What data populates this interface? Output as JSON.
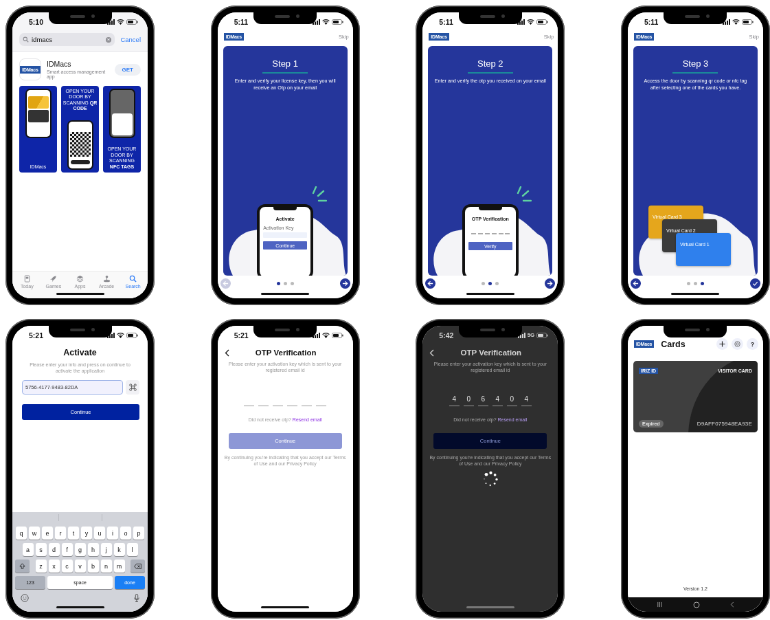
{
  "phones": [
    {
      "kind": "appstore",
      "time": "5:10",
      "search": {
        "value": "idmacs"
      },
      "cancel": "Cancel",
      "app": {
        "logo": "IDMacs",
        "name": "IDMacs",
        "subtitle": "Smart access management app",
        "button": "GET"
      },
      "previews": [
        {
          "kind": "cards",
          "caption": "IDMacs"
        },
        {
          "kind": "qr",
          "caption": "OPEN YOUR DOOR BY SCANNING **QR CODE**"
        },
        {
          "kind": "nfc",
          "caption": "OPEN YOUR DOOR BY SCANNING **NFC TAGS**"
        }
      ],
      "tabs": [
        {
          "label": "Today",
          "selected": false
        },
        {
          "label": "Games",
          "selected": false
        },
        {
          "label": "Apps",
          "selected": false
        },
        {
          "label": "Arcade",
          "selected": false
        },
        {
          "label": "Search",
          "selected": true
        }
      ]
    },
    {
      "kind": "onboarding",
      "time": "5:11",
      "logo": "IDMacs",
      "skip": "Skip",
      "title": "Step 1",
      "text": "Enter and verify your license key, then you will receive an Otp on your email",
      "illustration": {
        "kind": "activate",
        "title": "Activate",
        "field_label": "Activation Key",
        "button": "Continue"
      },
      "pages": [
        {
          "selected": true
        },
        {
          "selected": false
        },
        {
          "selected": false
        }
      ],
      "back_disabled": true,
      "last": false
    },
    {
      "kind": "onboarding",
      "time": "5:11",
      "logo": "IDMacs",
      "skip": "Skip",
      "title": "Step 2",
      "text": "Enter and verify the otp you received on your email",
      "illustration": {
        "kind": "otp",
        "title": "OTP Verification",
        "button": "Verify"
      },
      "pages": [
        {
          "selected": false
        },
        {
          "selected": true
        },
        {
          "selected": false
        }
      ],
      "back_disabled": false,
      "last": false
    },
    {
      "kind": "onboarding",
      "time": "5:11",
      "logo": "IDMacs",
      "skip": "Skip",
      "title": "Step 3",
      "text": "Access the door by scanning qr code or nfc tag after selecting one of the cards you have.",
      "illustration": {
        "kind": "cards",
        "cards": [
          {
            "label": "Virtual Card 3",
            "color": "#e5a61c"
          },
          {
            "label": "Virtual Card 2",
            "color": "#3b3b3b"
          },
          {
            "label": "Virtual Card 1",
            "color": "#2f80ed"
          }
        ]
      },
      "pages": [
        {
          "selected": false
        },
        {
          "selected": false
        },
        {
          "selected": true
        }
      ],
      "back_disabled": false,
      "last": true
    },
    {
      "kind": "activate",
      "time": "5:21",
      "title": "Activate",
      "subtitle": "Please enter your info and press on continue to activate the application",
      "field": {
        "value": "5756-4177-9483-82DA"
      },
      "button": "Continue",
      "keyboard": {
        "rows": [
          [
            "q",
            "w",
            "e",
            "r",
            "t",
            "y",
            "u",
            "i",
            "o",
            "p"
          ],
          [
            "a",
            "s",
            "d",
            "f",
            "g",
            "h",
            "j",
            "k",
            "l"
          ],
          [
            "z",
            "x",
            "c",
            "v",
            "b",
            "n",
            "m"
          ]
        ],
        "number_key": "123",
        "space_key": "space",
        "return_key": "done"
      }
    },
    {
      "kind": "otp",
      "time": "5:21",
      "title": "OTP Verification",
      "subtitle": "Please enter your activation key which is sent to your registered email id",
      "slots": [
        {
          "filled": false
        },
        {
          "filled": false
        },
        {
          "filled": false
        },
        {
          "filled": false
        },
        {
          "filled": false
        },
        {
          "filled": false
        }
      ],
      "prompt": "Did not receive otp?",
      "link": "Resend email",
      "button": "Continue",
      "button_disabled": true,
      "terms": "By continuing you're indicating that you accept our Terms of Use and our Privacy Policy",
      "loading": false
    },
    {
      "kind": "otp",
      "time": "5:42",
      "network": "5G",
      "title": "OTP Verification",
      "subtitle": "Please enter your activation key which is sent to your registered email id",
      "slots": [
        {
          "filled": true,
          "digit": "4"
        },
        {
          "filled": true,
          "digit": "0"
        },
        {
          "filled": true,
          "digit": "6"
        },
        {
          "filled": true,
          "digit": "4"
        },
        {
          "filled": true,
          "digit": "0"
        },
        {
          "filled": true,
          "digit": "4"
        }
      ],
      "prompt": "Did not receive otp?",
      "link": "Resend email",
      "button": "Continue",
      "button_disabled": false,
      "terms": "By continuing you're indicating that you accept our Terms of Use and our Privacy Policy",
      "loading": true
    },
    {
      "kind": "cards",
      "logo": "IDMacs",
      "title": "Cards",
      "help": "?",
      "cards": [
        {
          "brand": "IRIZ ID",
          "type": "VISITOR CARD",
          "status": "Expired",
          "number": "D9AFF075948EA93E"
        }
      ],
      "version": "Version 1.2"
    }
  ]
}
